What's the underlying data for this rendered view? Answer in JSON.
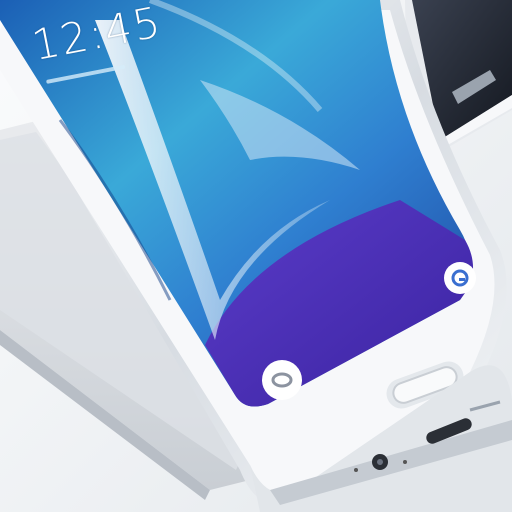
{
  "phone": {
    "clock_time": "12:45",
    "date_text": "",
    "colors": {
      "frame": "#e6e9ed",
      "screen_blue": "#2f7fd0",
      "screen_cyan": "#47c2dc",
      "screen_purple": "#4a2fb8",
      "bezel": "#f7f8fa",
      "dark_device": "#1f2430"
    },
    "icons": [
      "camera-icon",
      "home-button",
      "circle-app-icon",
      "usb-port",
      "earphone-jack"
    ]
  }
}
